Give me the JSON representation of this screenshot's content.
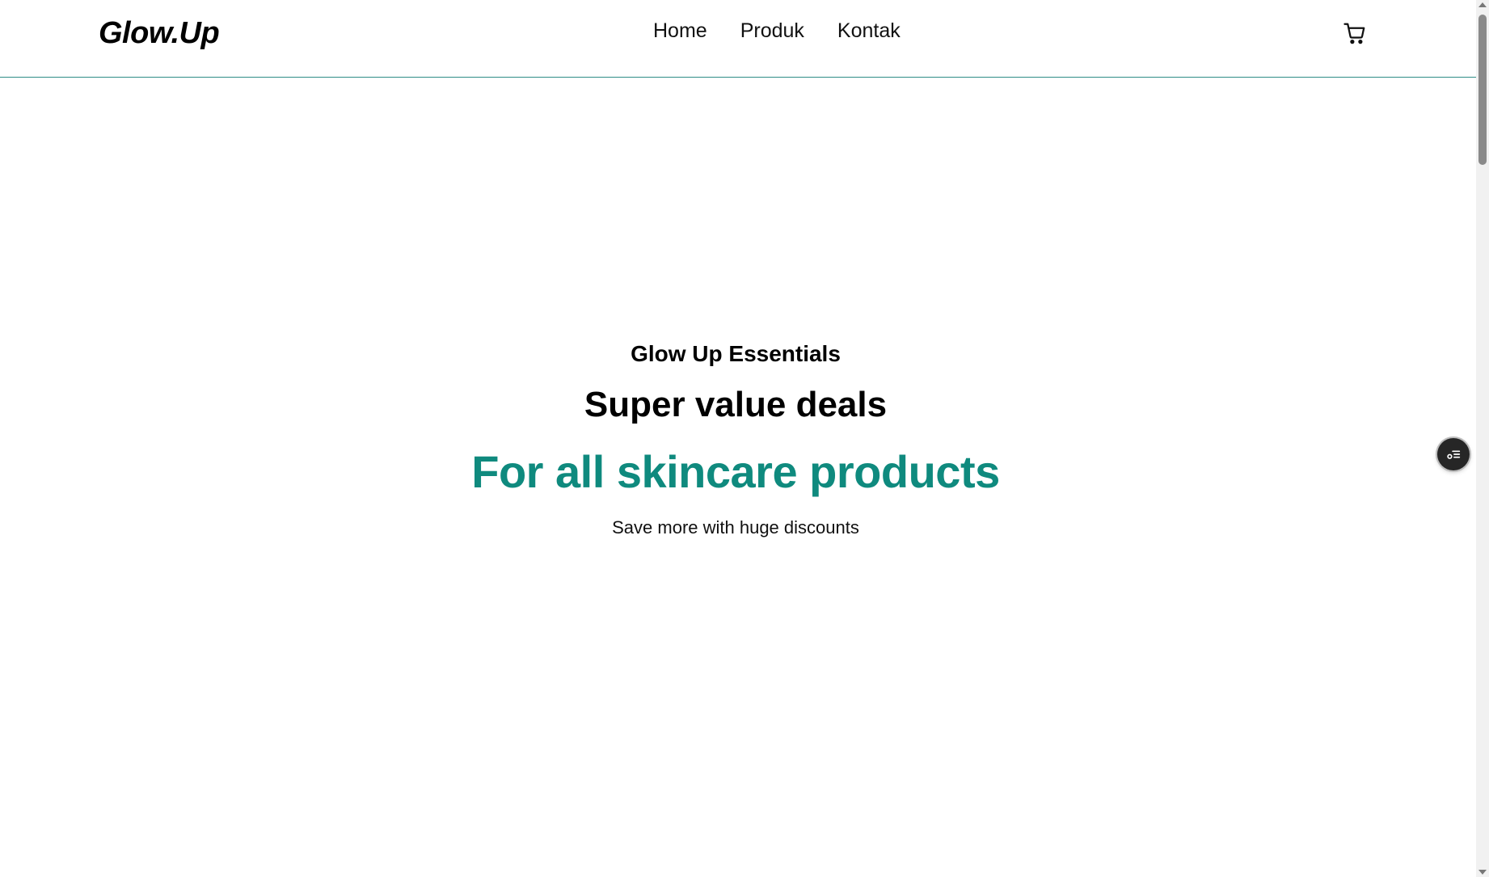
{
  "navbar": {
    "brand": "Glow.Up",
    "links": [
      "Home",
      "Produk",
      "Kontak"
    ],
    "cart_icon": "cart-icon"
  },
  "hero": {
    "eyebrow": "Glow Up Essentials",
    "headline": "Super value deals",
    "subheadline": "For all skincare products",
    "tagline": "Save more with huge discounts"
  },
  "floating_widget": {
    "icon": "settings-list-icon"
  },
  "colors": {
    "accent": "#0f8a7e",
    "navbar_border": "#2f8c86",
    "background": "#ffffff",
    "text": "#000000"
  }
}
